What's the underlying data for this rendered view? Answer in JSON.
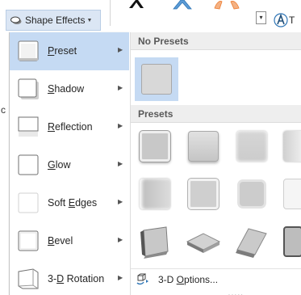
{
  "ribbon": {
    "shape_effects_label": "Shape Effects",
    "gallery_more_glyph": "▾",
    "text_partial": "T"
  },
  "menu": {
    "items": [
      {
        "key": "preset",
        "label": "Preset",
        "accel": "P",
        "selected": true
      },
      {
        "key": "shadow",
        "label": "Shadow",
        "accel": "S"
      },
      {
        "key": "reflection",
        "label": "Reflection",
        "accel": "R"
      },
      {
        "key": "glow",
        "label": "Glow",
        "accel": "G"
      },
      {
        "key": "soft-edges",
        "label": "Soft Edges",
        "accel": "E"
      },
      {
        "key": "bevel",
        "label": "Bevel",
        "accel": "B"
      },
      {
        "key": "3d-rotation",
        "label": "3-D Rotation",
        "accel": "D"
      }
    ],
    "left_edge_glyph": "c"
  },
  "submenu": {
    "no_presets_header": "No Presets",
    "presets_header": "Presets",
    "options_label": "3-D Options...",
    "options_accel": "O",
    "grip": "....."
  },
  "colors": {
    "accent_selected": "#c5daf3",
    "button_active_bg": "#dbe6f4",
    "header_bg": "#eeeeee",
    "text": "#262626"
  },
  "icons": {
    "arrow": "arrow-right-icon",
    "options": "3d-options-icon",
    "shape_effects": "shape-effects-icon"
  }
}
